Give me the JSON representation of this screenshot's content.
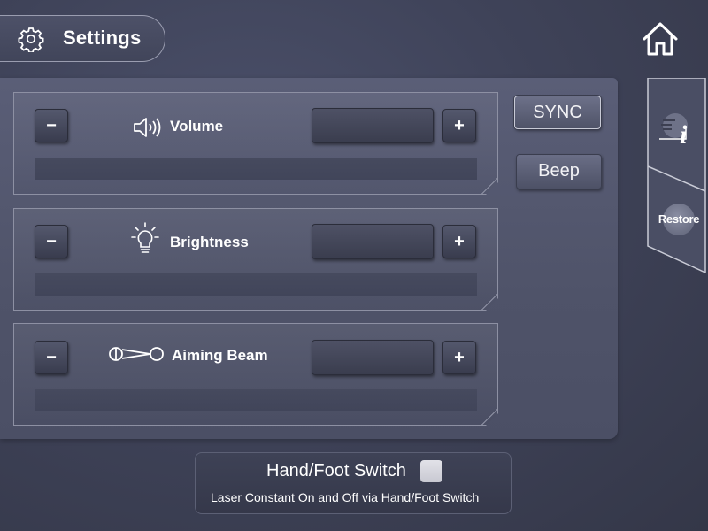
{
  "header": {
    "title": "Settings",
    "icon": "gear-icon"
  },
  "nav": {
    "home_icon": "home-icon"
  },
  "controls": [
    {
      "label": "Volume",
      "icon": "speaker-icon",
      "minus": "−",
      "plus": "+"
    },
    {
      "label": "Brightness",
      "icon": "lightbulb-icon",
      "minus": "−",
      "plus": "+"
    },
    {
      "label": "Aiming Beam",
      "icon": "aiming-beam-icon",
      "minus": "−",
      "plus": "+"
    }
  ],
  "buttons": {
    "sync": "SYNC",
    "beep": "Beep"
  },
  "side": {
    "info_icon": "info-icon",
    "restore": "Restore"
  },
  "switch": {
    "title": "Hand/Foot Switch",
    "description": "Laser Constant On  and Off via Hand/Foot Switch",
    "checked": false
  },
  "colors": {
    "background": "#3f4359",
    "panel": "#555971",
    "button": "#45485c"
  }
}
